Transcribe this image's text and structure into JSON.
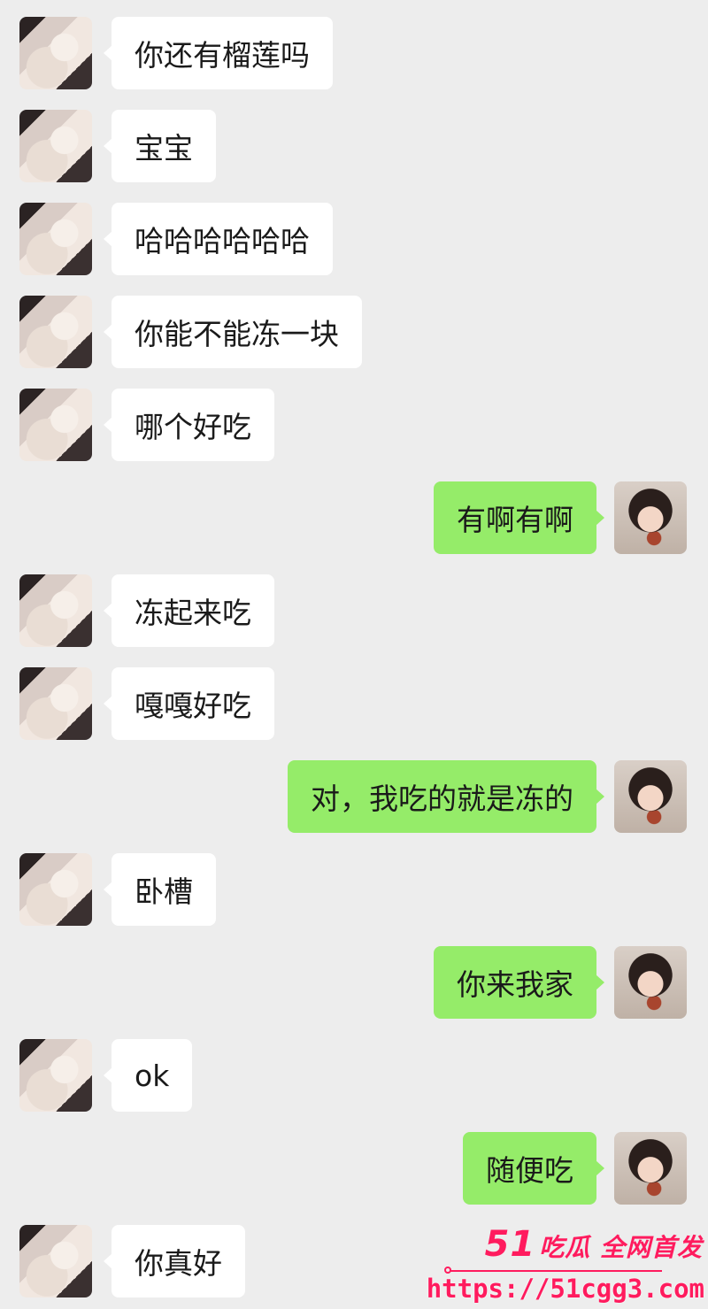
{
  "messages": [
    {
      "side": "left",
      "text": "你还有榴莲吗"
    },
    {
      "side": "left",
      "text": "宝宝"
    },
    {
      "side": "left",
      "text": "哈哈哈哈哈哈"
    },
    {
      "side": "left",
      "text": "你能不能冻一块"
    },
    {
      "side": "left",
      "text": "哪个好吃"
    },
    {
      "side": "right",
      "text": "有啊有啊"
    },
    {
      "side": "left",
      "text": "冻起来吃"
    },
    {
      "side": "left",
      "text": "嘎嘎好吃"
    },
    {
      "side": "right",
      "text": "对，我吃的就是冻的"
    },
    {
      "side": "left",
      "text": "卧槽"
    },
    {
      "side": "right",
      "text": "你来我家"
    },
    {
      "side": "left",
      "text": "ok"
    },
    {
      "side": "right",
      "text": "随便吃"
    },
    {
      "side": "left",
      "text": "你真好"
    }
  ],
  "watermark": {
    "brand_number": "51",
    "brand_text": "吃瓜 全网首发",
    "url": "https://51cgg3.com"
  },
  "colors": {
    "background": "#ededed",
    "incoming_bubble": "#ffffff",
    "outgoing_bubble": "#95ec69",
    "watermark": "#ff1b5e"
  }
}
